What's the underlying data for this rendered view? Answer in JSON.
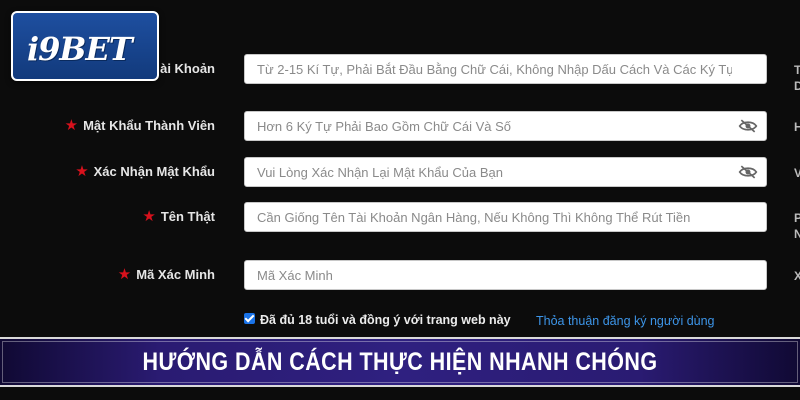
{
  "brand": {
    "logo_text": "i9BET"
  },
  "form": {
    "fields": [
      {
        "label": "Tài Khoản",
        "label_visible": "ài Khoản",
        "required": false,
        "placeholder": "Từ 2-15 Kí Tự, Phải Bắt Đầu Bằng Chữ Cái, Không Nhập Dấu Cách Và Các Ký Tự Đặc",
        "value": "",
        "side_hint": "T",
        "side_hint_2": "D"
      },
      {
        "label": "Mật Khẩu Thành Viên",
        "required": true,
        "placeholder": "Hơn 6 Ký Tự Phải Bao Gồm Chữ Cái Và Số",
        "value": "",
        "icon": "eye-slash-icon",
        "side_hint": "H"
      },
      {
        "label": "Xác Nhận Mật Khẩu",
        "required": true,
        "placeholder": "Vui Lòng Xác Nhận Lại Mật Khẩu Của Bạn",
        "value": "",
        "icon": "eye-slash-icon",
        "side_hint": "V"
      },
      {
        "label": "Tên Thật",
        "required": true,
        "placeholder": "Cần Giống Tên Tài Khoản Ngân Hàng, Nếu Không Thì Không Thể Rút Tiền",
        "value": "",
        "side_hint": "P",
        "side_hint_2": "N"
      },
      {
        "label": "Mã Xác Minh",
        "required": true,
        "placeholder": "Mã Xác Minh",
        "value": "",
        "side_hint": "X"
      }
    ],
    "agree": {
      "checked": true,
      "text": "Đã đủ 18 tuổi và đồng ý với trang web này"
    },
    "terms_link": "Thỏa thuận đăng ký người dùng"
  },
  "banner": {
    "title": "HƯỚNG DẪN CÁCH THỰC HIỆN NHANH CHÓNG"
  },
  "colors": {
    "background": "#0c0c0c",
    "required_star": "#d8111c",
    "link": "#3d95e8",
    "banner": "#2f2080",
    "logo_bg": "#1e4fa0"
  }
}
